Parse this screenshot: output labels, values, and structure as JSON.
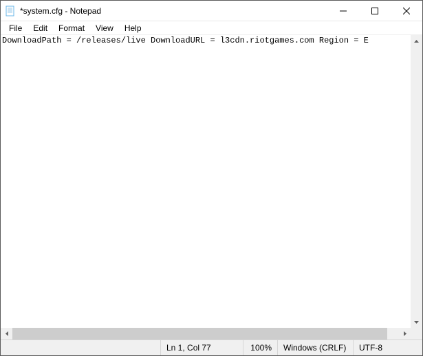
{
  "window": {
    "title": "*system.cfg - Notepad"
  },
  "menu": {
    "file": "File",
    "edit": "Edit",
    "format": "Format",
    "view": "View",
    "help": "Help"
  },
  "content": {
    "text": "DownloadPath = /releases/live DownloadURL = l3cdn.riotgames.com Region = E"
  },
  "status": {
    "position": "Ln 1, Col 77",
    "zoom": "100%",
    "eol": "Windows (CRLF)",
    "encoding": "UTF-8"
  }
}
